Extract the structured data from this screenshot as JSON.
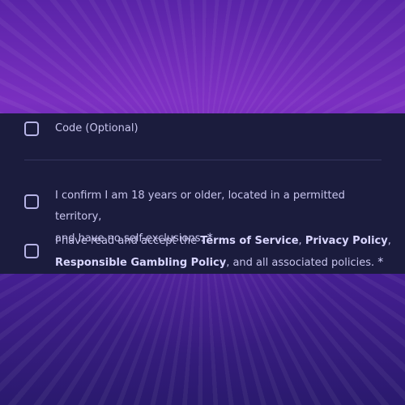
{
  "code_optional": {
    "label": "Code (Optional)"
  },
  "age_confirm": {
    "line1": "I confirm I am 18 years or older, located in a permitted territory,",
    "line2": "and have no self-exclusions.",
    "required_mark": "*"
  },
  "terms": {
    "prefix": "I have read and accept the ",
    "terms_link": "Terms of Service",
    "sep1": ", ",
    "privacy_link": "Privacy Policy",
    "sep2": ",",
    "rg_link": "Responsible Gambling Policy",
    "suffix": ", and all associated policies.",
    "required_mark": "*"
  },
  "colors": {
    "panel_bg": "#1b1c3d",
    "text": "#c9c6ee",
    "checkbox_border": "#b7b4e6"
  }
}
